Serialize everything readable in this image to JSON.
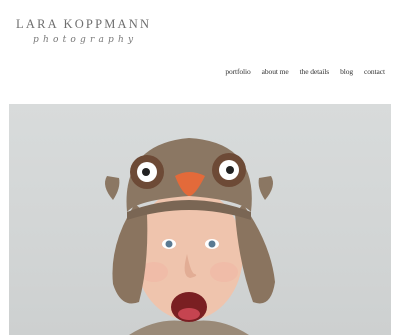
{
  "header": {
    "logo_name": "LARA KOPPMANN",
    "logo_tagline": "photography"
  },
  "nav": {
    "items": [
      {
        "label": "portfolio"
      },
      {
        "label": "about me"
      },
      {
        "label": "the details"
      },
      {
        "label": "blog"
      },
      {
        "label": "contact"
      }
    ]
  },
  "hero": {
    "image_icon": "photo-icon"
  }
}
